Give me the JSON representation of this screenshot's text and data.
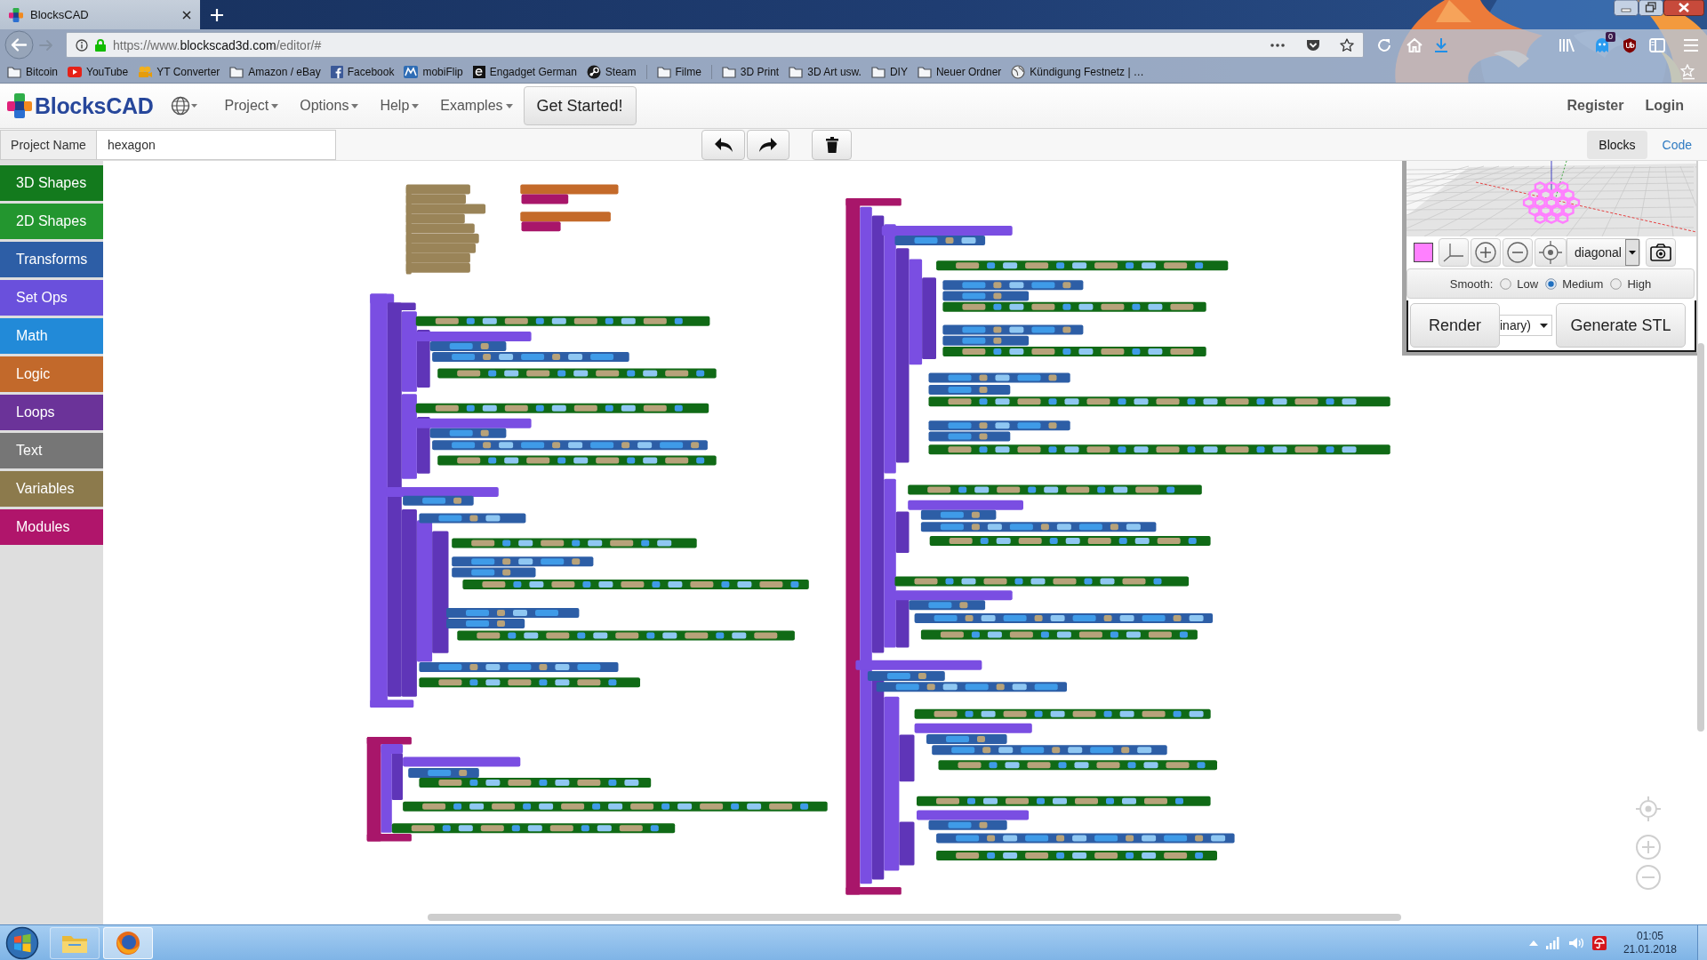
{
  "browser": {
    "tab": {
      "title": "BlocksCAD"
    },
    "address": {
      "scheme": "https://www.",
      "domain": "blockscad3d.com",
      "path": "/editor/#"
    },
    "extension_badge": "0",
    "bookmarks": [
      {
        "kind": "folder",
        "label": "Bitcoin"
      },
      {
        "kind": "youtube",
        "label": "YouTube"
      },
      {
        "kind": "camera",
        "label": "YT Converter"
      },
      {
        "kind": "folder",
        "label": "Amazon / eBay"
      },
      {
        "kind": "facebook",
        "label": "Facebook"
      },
      {
        "kind": "mobiflip",
        "label": "mobiFlip"
      },
      {
        "kind": "engadget",
        "label": "Engadget German"
      },
      {
        "kind": "steam",
        "label": "Steam"
      },
      {
        "kind": "separator"
      },
      {
        "kind": "folder",
        "label": "Filme"
      },
      {
        "kind": "separator"
      },
      {
        "kind": "folder",
        "label": "3D Print"
      },
      {
        "kind": "folder",
        "label": "3D Art usw."
      },
      {
        "kind": "folder",
        "label": "DIY"
      },
      {
        "kind": "folder",
        "label": "Neuer Ordner"
      },
      {
        "kind": "globe",
        "label": "Kündigung Festnetz | …"
      }
    ]
  },
  "app": {
    "brand": "BlocksCAD",
    "menus": [
      "Project",
      "Options",
      "Help",
      "Examples"
    ],
    "get_started": "Get Started!",
    "account_links": [
      "Register",
      "Login"
    ],
    "project_name": {
      "label": "Project Name",
      "value": "hexagon"
    },
    "view_tabs": [
      {
        "label": "Blocks",
        "selected": true
      },
      {
        "label": "Code",
        "selected": false
      }
    ],
    "categories": [
      {
        "label": "3D Shapes",
        "color": "#137a1d"
      },
      {
        "label": "2D Shapes",
        "color": "#23962f"
      },
      {
        "label": "Transforms",
        "color": "#2d5ea6"
      },
      {
        "label": "Set Ops",
        "color": "#6a50dc"
      },
      {
        "label": "Math",
        "color": "#228ad8"
      },
      {
        "label": "Logic",
        "color": "#c2692b"
      },
      {
        "label": "Loops",
        "color": "#6b3399"
      },
      {
        "label": "Text",
        "color": "#767676"
      },
      {
        "label": "Variables",
        "color": "#8c7a4c"
      },
      {
        "label": "Modules",
        "color": "#b0156b"
      }
    ],
    "preview": {
      "color": "#ff80ff",
      "view": "diagonal",
      "smooth": {
        "label": "Smooth:",
        "options": [
          {
            "label": "Low",
            "selected": false
          },
          {
            "label": "Medium",
            "selected": true
          },
          {
            "label": "High",
            "selected": false
          }
        ]
      },
      "render": "Render",
      "stl_format": "inary)",
      "generate": "Generate STL"
    }
  },
  "taskbar": {
    "apps": [
      {
        "kind": "explorer",
        "selected": false
      },
      {
        "kind": "firefox",
        "selected": true
      }
    ],
    "time": "01:05",
    "date": "21.01.2018"
  }
}
